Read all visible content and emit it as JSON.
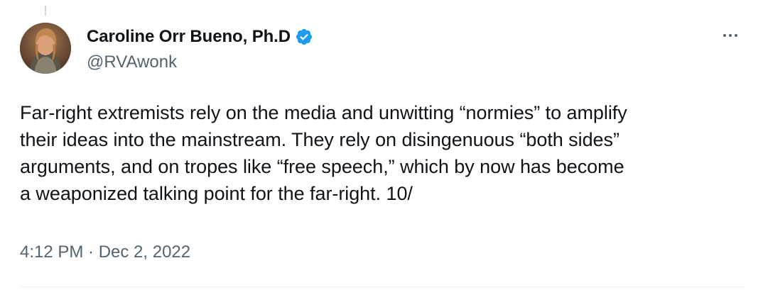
{
  "tweet": {
    "author": {
      "display_name": "Caroline Orr Bueno, Ph.D",
      "handle": "@RVAwonk",
      "verified": true
    },
    "text": "Far-right extremists rely on the media and unwitting “normies” to amplify\ntheir ideas into the mainstream. They rely on disingenuous “both sides”\narguments, and on tropes like “free speech,” which by now has become\na weaponized talking point for the far-right. 10/",
    "timestamp": "4:12 PM · Dec 2, 2022"
  },
  "icons": {
    "verified": "verified-badge-icon",
    "more": "more-horizontal-icon"
  },
  "colors": {
    "verified_blue": "#1d9bf0",
    "text_primary": "#0f1419",
    "text_secondary": "#536471"
  }
}
